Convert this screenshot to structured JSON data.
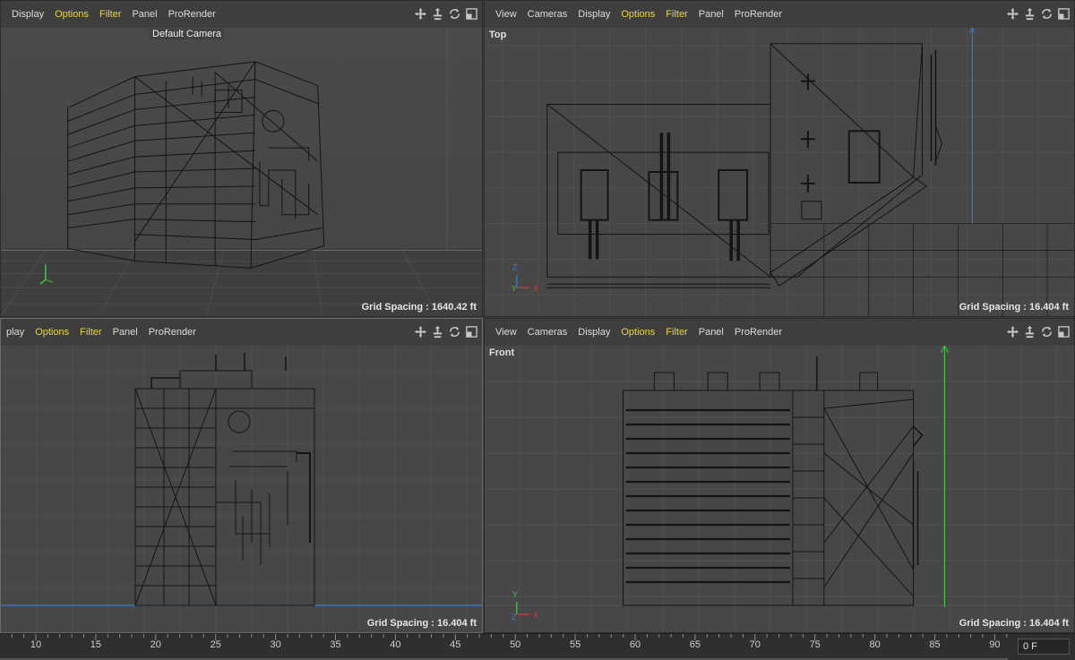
{
  "viewports": {
    "perspective": {
      "menu": [
        "Display",
        "Options",
        "Filter",
        "Panel",
        "ProRender"
      ],
      "camera_label": "Default Camera",
      "grid_spacing": "Grid Spacing : 1640.42 ft"
    },
    "top": {
      "menu": [
        "View",
        "Cameras",
        "Display",
        "Options",
        "Filter",
        "Panel",
        "ProRender"
      ],
      "label": "Top",
      "grid_spacing": "Grid Spacing : 16.404 ft"
    },
    "right": {
      "menu": [
        "play",
        "Options",
        "Filter",
        "Panel",
        "ProRender"
      ],
      "grid_spacing": "Grid Spacing : 16.404 ft"
    },
    "front": {
      "menu": [
        "View",
        "Cameras",
        "Display",
        "Options",
        "Filter",
        "Panel",
        "ProRender"
      ],
      "label": "Front",
      "grid_spacing": "Grid Spacing : 16.404 ft"
    }
  },
  "highlighted_menu_items": [
    "Options",
    "Filter"
  ],
  "view_icons": [
    "move-view-icon",
    "pan-view-icon",
    "rotate-view-icon",
    "maximize-view-icon"
  ],
  "axis_labels": {
    "x": "X",
    "y": "Y",
    "z": "Z"
  },
  "timeline": {
    "ticks": [
      "10",
      "15",
      "20",
      "25",
      "30",
      "35",
      "40",
      "45",
      "50",
      "55",
      "60",
      "65",
      "70",
      "75",
      "80",
      "85",
      "90"
    ],
    "current_frame": "0 F"
  },
  "colors": {
    "highlight": "#e6d44a",
    "axis_x": "#d23a3a",
    "axis_y": "#4ac24a",
    "axis_z": "#3a78d2"
  }
}
